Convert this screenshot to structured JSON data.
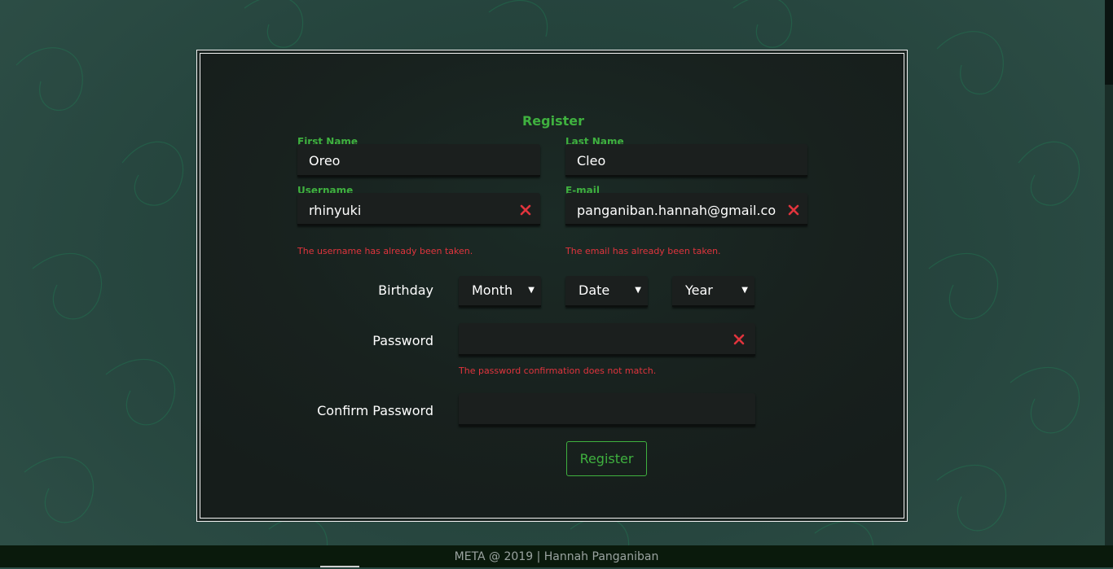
{
  "form": {
    "title": "Register",
    "first_name": {
      "label": "First Name",
      "value": "Oreo"
    },
    "last_name": {
      "label": "Last Name",
      "value": "Cleo"
    },
    "username": {
      "label": "Username",
      "value": "rhinyuki",
      "error": "The username has already been taken."
    },
    "email": {
      "label": "E-mail",
      "value": "panganiban.hannah@gmail.com",
      "error": "The email has already been taken."
    },
    "birthday": {
      "label": "Birthday",
      "month": "Month",
      "date": "Date",
      "year": "Year"
    },
    "password": {
      "label": "Password",
      "value": "",
      "error": "The password confirmation does not match."
    },
    "confirm_password": {
      "label": "Confirm Password",
      "value": ""
    },
    "submit_label": "Register"
  },
  "footer": {
    "text": "META @ 2019 | Hannah Panganiban"
  },
  "colors": {
    "accent": "#3fb13f",
    "error": "#e0343d",
    "footer_bg": "#0a1a0c"
  },
  "icons": {
    "error_icon": "x-icon",
    "select_caret": "caret-down-icon"
  }
}
